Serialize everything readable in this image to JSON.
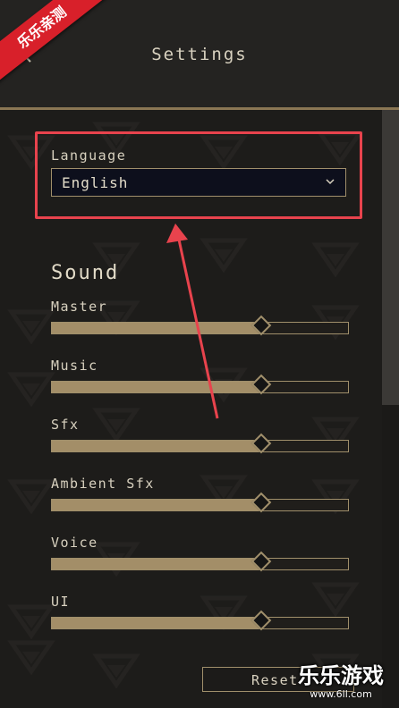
{
  "header": {
    "title": "Settings",
    "back_icon": "back-arrow-icon"
  },
  "language": {
    "label": "Language",
    "selected": "English",
    "chevron_icon": "chevron-down-icon"
  },
  "sound": {
    "title": "Sound",
    "sliders": [
      {
        "label": "Master",
        "value_fraction": 0.71
      },
      {
        "label": "Music",
        "value_fraction": 0.71
      },
      {
        "label": "Sfx",
        "value_fraction": 0.71
      },
      {
        "label": "Ambient Sfx",
        "value_fraction": 0.71
      },
      {
        "label": "Voice",
        "value_fraction": 0.71
      },
      {
        "label": "UI",
        "value_fraction": 0.71
      }
    ]
  },
  "reset": {
    "label": "Reset"
  },
  "overlays": {
    "corner_badge": "乐乐亲测",
    "watermark_main": "乐乐游戏",
    "watermark_url": "www.6ll.com",
    "highlight_color": "#e8434d",
    "accent_color": "#a08f6b"
  }
}
